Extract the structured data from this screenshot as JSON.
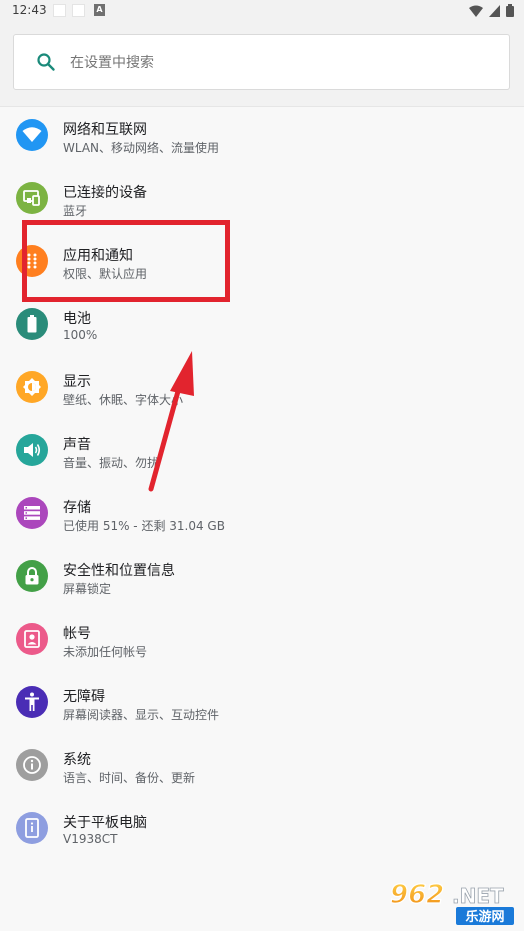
{
  "status_bar": {
    "time": "12:43",
    "notif_icon": "A"
  },
  "search": {
    "placeholder": "在设置中搜索"
  },
  "settings": [
    {
      "icon": "wifi-icon",
      "color": "#2196f3",
      "title": "网络和互联网",
      "subtitle": "WLAN、移动网络、流量使用"
    },
    {
      "icon": "devices-icon",
      "color": "#7cb342",
      "title": "已连接的设备",
      "subtitle": "蓝牙"
    },
    {
      "icon": "apps-icon",
      "color": "#ff7f1f",
      "title": "应用和通知",
      "subtitle": "权限、默认应用"
    },
    {
      "icon": "battery-icon",
      "color": "#2a8c7a",
      "title": "电池",
      "subtitle": "100%"
    },
    {
      "icon": "brightness-icon",
      "color": "#ffa726",
      "title": "显示",
      "subtitle": "壁纸、休眠、字体大小"
    },
    {
      "icon": "volume-icon",
      "color": "#26a69a",
      "title": "声音",
      "subtitle": "音量、振动、勿扰"
    },
    {
      "icon": "storage-icon",
      "color": "#ab47bc",
      "title": "存储",
      "subtitle": "已使用 51% - 还剩 31.04 GB"
    },
    {
      "icon": "lock-icon",
      "color": "#43a047",
      "title": "安全性和位置信息",
      "subtitle": "屏幕锁定"
    },
    {
      "icon": "account-icon",
      "color": "#ec5a8a",
      "title": "帐号",
      "subtitle": "未添加任何帐号"
    },
    {
      "icon": "accessibility-icon",
      "color": "#4a2db5",
      "title": "无障碍",
      "subtitle": "屏幕阅读器、显示、互动控件"
    },
    {
      "icon": "info-icon",
      "color": "#9e9e9e",
      "title": "系统",
      "subtitle": "语言、时间、备份、更新"
    },
    {
      "icon": "phone-info-icon",
      "color": "#8e9ee0",
      "title": "关于平板电脑",
      "subtitle": "V1938CT"
    }
  ],
  "annotation": {
    "color": "#e2242e"
  },
  "watermark": {
    "brand": "962.NET",
    "tagline": "乐游网"
  }
}
